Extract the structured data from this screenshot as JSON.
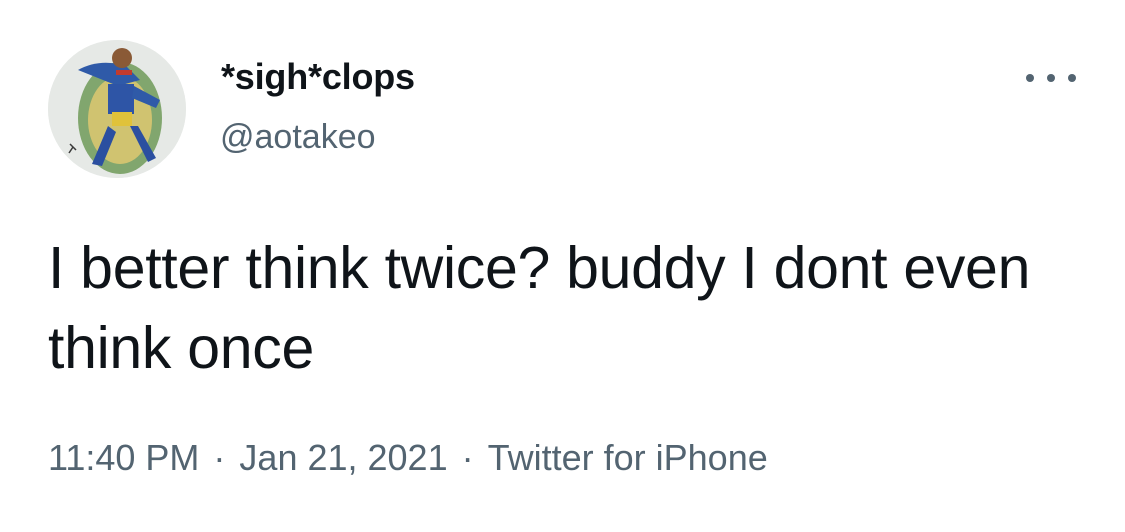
{
  "tweet": {
    "display_name": "*sigh*clops",
    "handle": "@aotakeo",
    "text": "I better think twice? buddy I dont even think once",
    "time": "11:40 PM",
    "separator": "·",
    "date": "Jan 21, 2021",
    "source": "Twitter for iPhone",
    "more_icon": "more-horizontal-icon",
    "avatar_icon": "avatar-drawing-icon"
  },
  "colors": {
    "text_primary": "#0f1419",
    "text_secondary": "#536471",
    "background": "#ffffff"
  }
}
